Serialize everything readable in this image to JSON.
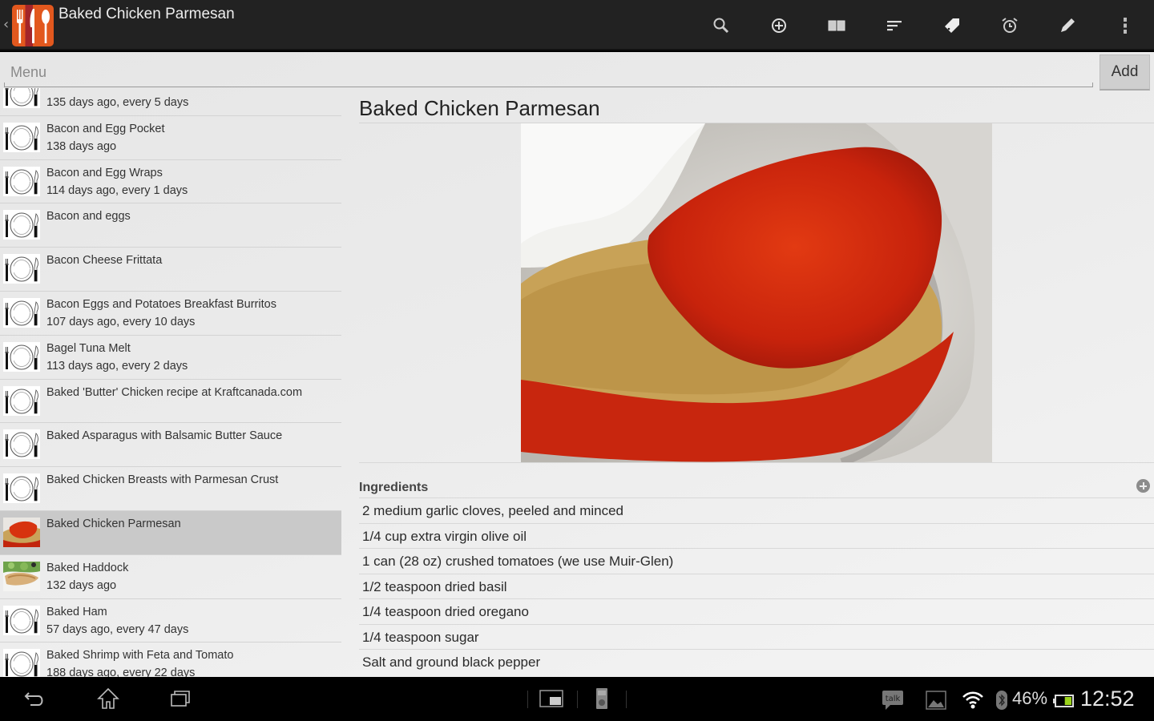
{
  "app": {
    "title": "Baked Chicken Parmesan",
    "action_icons": [
      {
        "name": "search-icon",
        "label": "Search"
      },
      {
        "name": "add-circle-icon",
        "label": "Add"
      },
      {
        "name": "book-icon",
        "label": "Cookbook"
      },
      {
        "name": "sort-icon",
        "label": "Sort"
      },
      {
        "name": "tag-icon",
        "label": "Tag"
      },
      {
        "name": "alarm-icon",
        "label": "Timer"
      },
      {
        "name": "pencil-icon",
        "label": "Edit"
      },
      {
        "name": "overflow-menu-icon",
        "label": "More"
      }
    ]
  },
  "menu_input": {
    "placeholder": "Menu",
    "value": ""
  },
  "add_button": {
    "label": "Add"
  },
  "recipes": [
    {
      "name": "",
      "sub": "135 days ago, every 5 days",
      "thumb": "plate",
      "selected": false
    },
    {
      "name": "Bacon and Egg Pocket",
      "sub": "138 days ago",
      "thumb": "plate",
      "selected": false
    },
    {
      "name": "Bacon and Egg Wraps",
      "sub": "114 days ago, every 1 days",
      "thumb": "plate",
      "selected": false
    },
    {
      "name": "Bacon and eggs",
      "sub": "",
      "thumb": "plate",
      "selected": false
    },
    {
      "name": "Bacon Cheese Frittata",
      "sub": "",
      "thumb": "plate",
      "selected": false
    },
    {
      "name": "Bacon Eggs and Potatoes Breakfast Burritos",
      "sub": "107 days ago, every 10 days",
      "thumb": "plate",
      "selected": false
    },
    {
      "name": "Bagel Tuna Melt",
      "sub": "113 days ago, every 2 days",
      "thumb": "plate",
      "selected": false
    },
    {
      "name": "Baked 'Butter' Chicken recipe at Kraftcanada.com",
      "sub": "",
      "thumb": "plate",
      "selected": false
    },
    {
      "name": "Baked Asparagus with Balsamic Butter Sauce",
      "sub": "",
      "thumb": "plate",
      "selected": false
    },
    {
      "name": "Baked Chicken Breasts with Parmesan Crust",
      "sub": "",
      "thumb": "plate",
      "selected": false
    },
    {
      "name": "Baked Chicken Parmesan",
      "sub": "",
      "thumb": "chicken-photo",
      "selected": true
    },
    {
      "name": "Baked Haddock",
      "sub": "132 days ago",
      "thumb": "haddock-photo",
      "selected": false
    },
    {
      "name": "Baked Ham",
      "sub": "57 days ago, every 47 days",
      "thumb": "plate",
      "selected": false
    },
    {
      "name": "Baked Shrimp with Feta and Tomato",
      "sub": "188 days ago, every 22 days",
      "thumb": "plate",
      "selected": false
    }
  ],
  "detail": {
    "title": "Baked Chicken Parmesan",
    "ingredients_header": "Ingredients",
    "ingredients": [
      "2 medium garlic cloves, peeled and minced",
      "1/4 cup extra virgin olive oil",
      "1 can (28 oz) crushed tomatoes (we use Muir-Glen)",
      "1/2 teaspoon dried basil",
      "1/4 teaspoon dried oregano",
      "1/4 teaspoon sugar",
      "Salt and ground black pepper"
    ]
  },
  "status_bar": {
    "battery_percent": "46%",
    "battery_level": 0.46,
    "clock": "12:52",
    "notification_talk": "talk"
  }
}
